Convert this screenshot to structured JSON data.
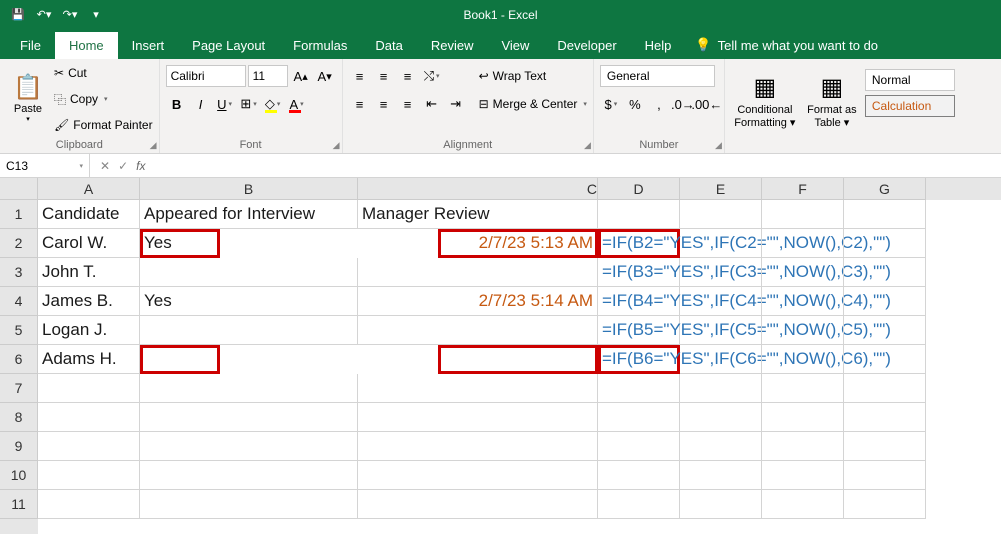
{
  "title": "Book1 - Excel",
  "tabs": {
    "file": "File",
    "home": "Home",
    "insert": "Insert",
    "pageLayout": "Page Layout",
    "formulas": "Formulas",
    "data": "Data",
    "review": "Review",
    "view": "View",
    "developer": "Developer",
    "help": "Help",
    "tellMe": "Tell me what you want to do"
  },
  "ribbon": {
    "clipboard": {
      "paste": "Paste",
      "cut": "Cut",
      "copy": "Copy",
      "painter": "Format Painter",
      "label": "Clipboard"
    },
    "font": {
      "name": "Calibri",
      "size": "11",
      "label": "Font"
    },
    "alignment": {
      "wrap": "Wrap Text",
      "merge": "Merge & Center",
      "label": "Alignment"
    },
    "number": {
      "format": "General",
      "label": "Number"
    },
    "styles": {
      "cond": "Conditional",
      "cond2": "Formatting",
      "table": "Format as",
      "table2": "Table",
      "normal": "Normal",
      "calc": "Calculation"
    }
  },
  "nameBox": "C13",
  "formulaInput": "",
  "columns": [
    "A",
    "B",
    "C",
    "D",
    "E",
    "F",
    "G"
  ],
  "rowNums": [
    "1",
    "2",
    "3",
    "4",
    "5",
    "6",
    "7",
    "8",
    "9",
    "10",
    "11"
  ],
  "headers": {
    "A": "Candidate",
    "B": "Appeared for Interview",
    "C": "Manager Review"
  },
  "rows": [
    {
      "A": "Carol W.",
      "B": "Yes",
      "C": "2/7/23 5:13 AM",
      "D": "=IF(B2=\"YES\",IF(C2=\"\",NOW(),C2),\"\")",
      "hlB": true,
      "hlC": true,
      "hlD": true,
      "thick": true
    },
    {
      "A": "John T.",
      "B": "",
      "C": "",
      "D": "=IF(B3=\"YES\",IF(C3=\"\",NOW(),C3),\"\")"
    },
    {
      "A": "James B.",
      "B": "Yes",
      "C": "2/7/23 5:14 AM",
      "D": "=IF(B4=\"YES\",IF(C4=\"\",NOW(),C4),\"\")"
    },
    {
      "A": "Logan J.",
      "B": "",
      "C": "",
      "D": "=IF(B5=\"YES\",IF(C5=\"\",NOW(),C5),\"\")"
    },
    {
      "A": "Adams H.",
      "B": "",
      "C": "",
      "D": "=IF(B6=\"YES\",IF(C6=\"\",NOW(),C6),\"\")",
      "hlB": true,
      "hlC": true,
      "hlD": true,
      "thick": true
    }
  ]
}
